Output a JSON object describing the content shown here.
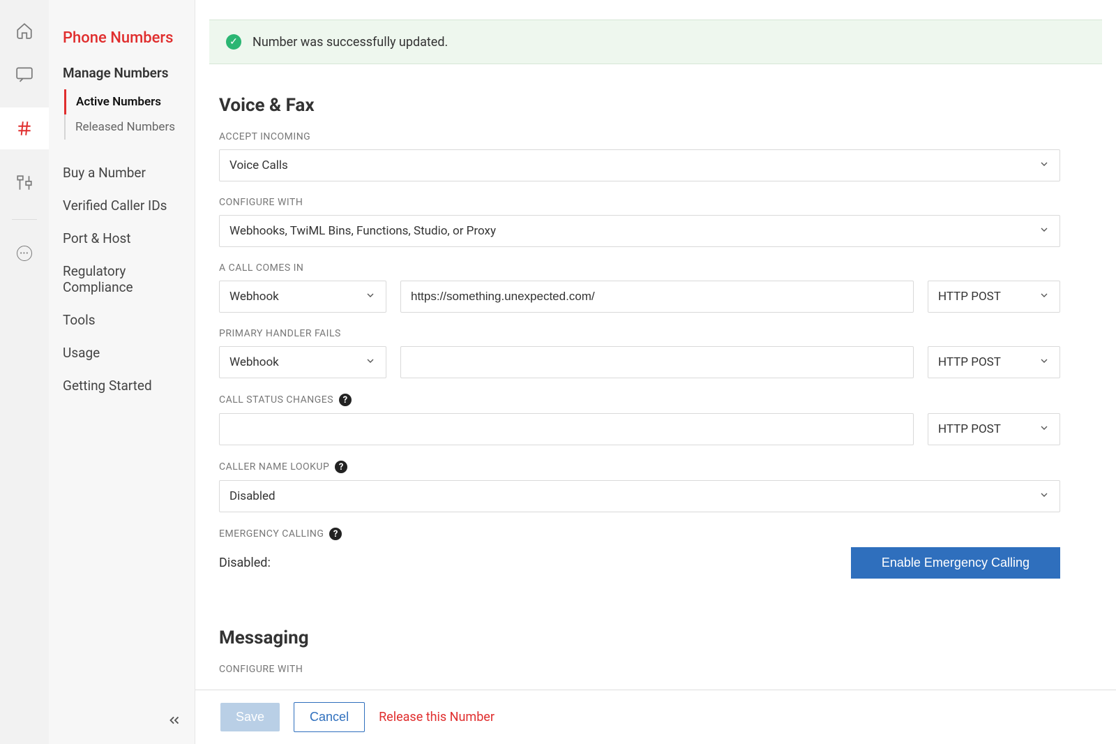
{
  "rail": {
    "icons": [
      "home",
      "chat",
      "hash",
      "settings",
      "more"
    ]
  },
  "sidebar": {
    "title": "Phone Numbers",
    "group": "Manage Numbers",
    "subitems": [
      {
        "label": "Active Numbers",
        "active": true
      },
      {
        "label": "Released Numbers",
        "active": false
      }
    ],
    "items": [
      "Buy a Number",
      "Verified Caller IDs",
      "Port & Host",
      "Regulatory Compliance",
      "Tools",
      "Usage",
      "Getting Started"
    ]
  },
  "alert": {
    "text": "Number was successfully updated."
  },
  "voicefax": {
    "heading": "Voice & Fax",
    "accept_incoming_label": "Accept Incoming",
    "accept_incoming_value": "Voice Calls",
    "configure_with_label": "Configure With",
    "configure_with_value": "Webhooks, TwiML Bins, Functions, Studio, or Proxy",
    "call_comes_in_label": "A Call Comes In",
    "call_comes_in_type": "Webhook",
    "call_comes_in_url": "https://something.unexpected.com/",
    "call_comes_in_method": "HTTP POST",
    "primary_fails_label": "Primary Handler Fails",
    "primary_fails_type": "Webhook",
    "primary_fails_url": "",
    "primary_fails_method": "HTTP POST",
    "call_status_label": "Call Status Changes",
    "call_status_url": "",
    "call_status_method": "HTTP POST",
    "caller_name_label": "Caller Name Lookup",
    "caller_name_value": "Disabled",
    "emergency_label": "Emergency Calling",
    "emergency_status": "Disabled:",
    "emergency_button": "Enable Emergency Calling"
  },
  "messaging": {
    "heading": "Messaging",
    "configure_with_label": "Configure With"
  },
  "footer": {
    "save": "Save",
    "cancel": "Cancel",
    "release": "Release this Number"
  }
}
